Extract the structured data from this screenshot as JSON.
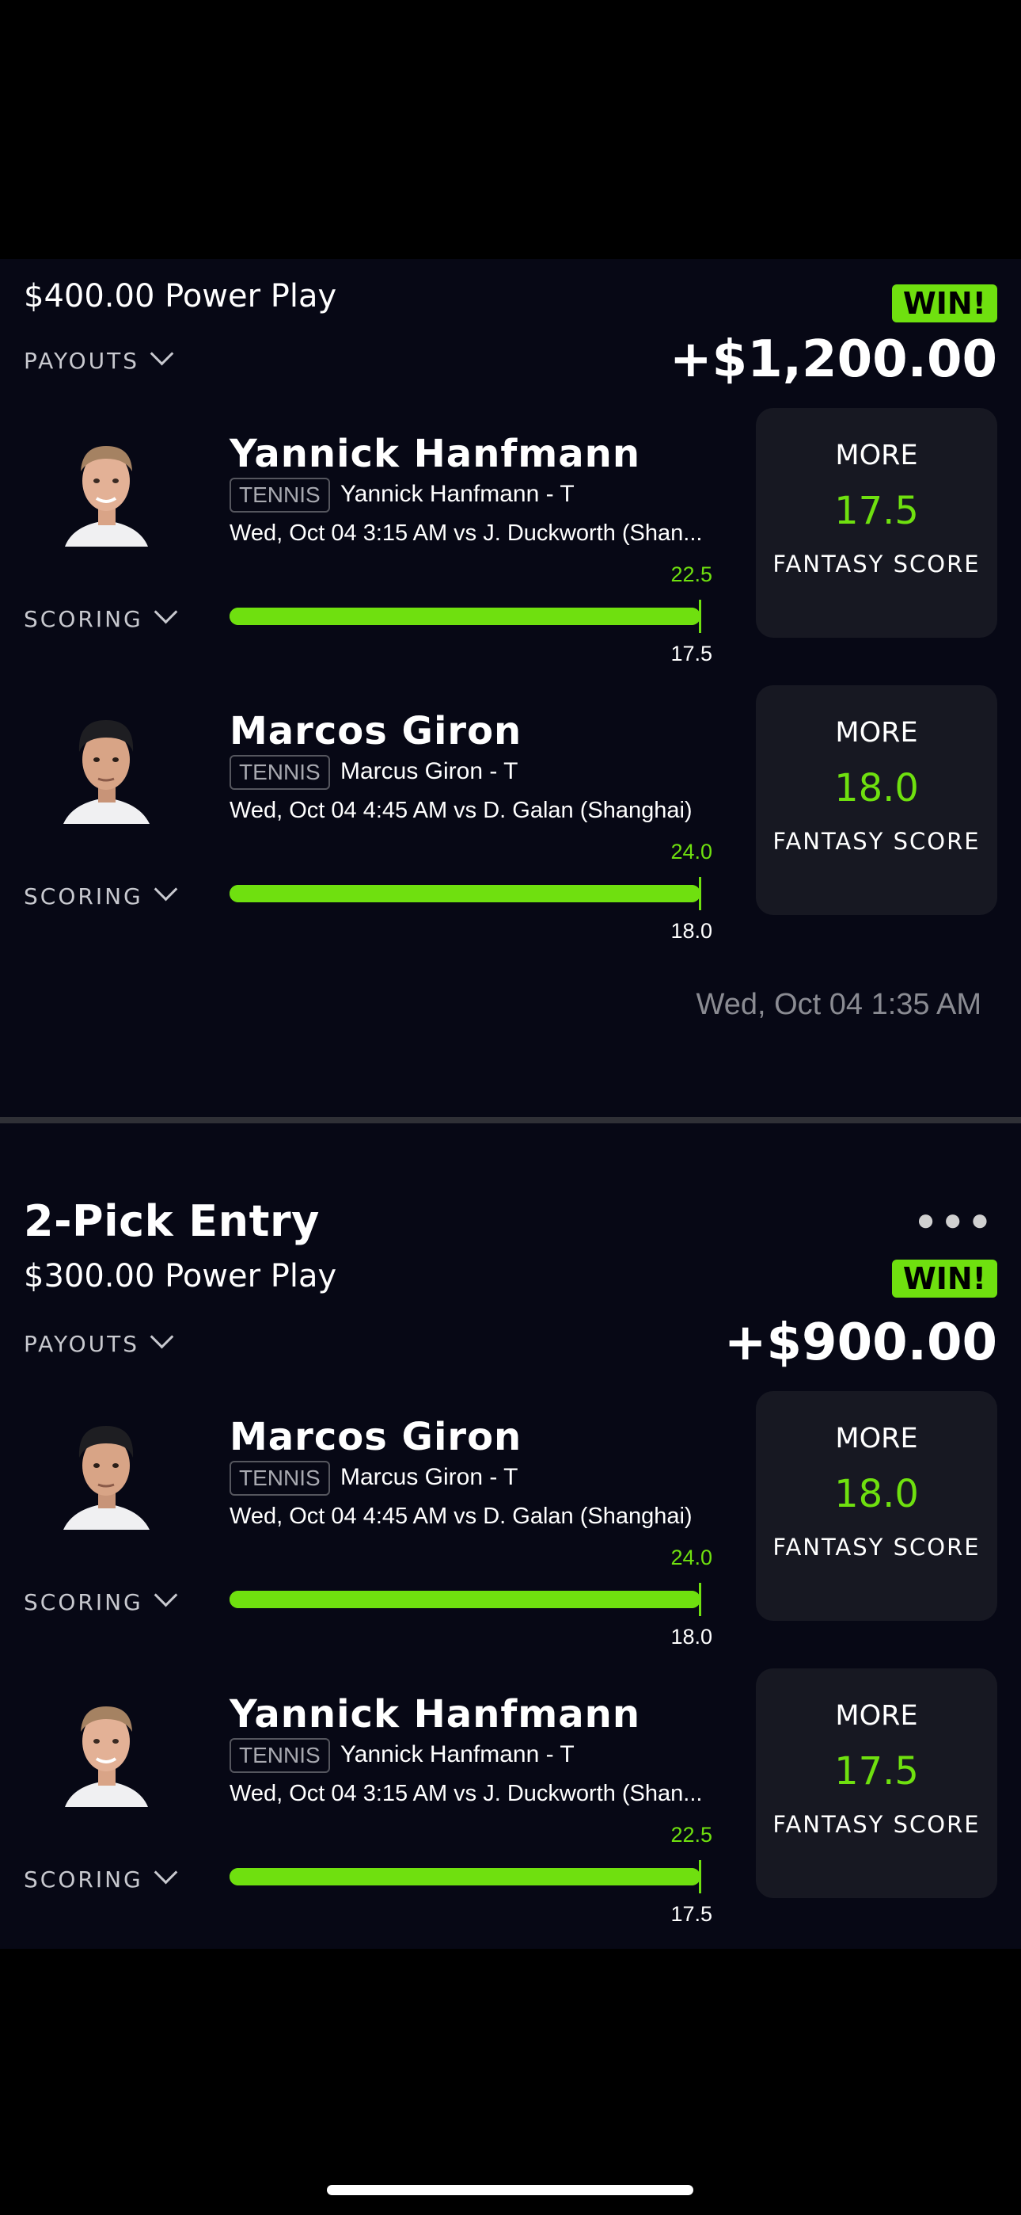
{
  "colors": {
    "accent": "#6fe00f",
    "background": "#070815",
    "panel": "#171822"
  },
  "entries": [
    {
      "power": "$400.00 Power Play",
      "badge": "WIN!",
      "payouts_label": "PAYOUTS",
      "amount": "+$1,200.00",
      "timestamp": "Wed, Oct 04 1:35 AM",
      "picks": [
        {
          "name": "Yannick Hanfmann",
          "sport": "TENNIS",
          "prop": "Yannick Hanfmann - T",
          "game": "Wed, Oct 04 3:15 AM  vs J. Duckworth (Shan...",
          "actual": "22.5",
          "line": "17.5",
          "progress": 1.0,
          "scoring_label": "SCORING",
          "direction": "MORE",
          "projection": "17.5",
          "stat": "FANTASY SCORE"
        },
        {
          "name": "Marcos Giron",
          "sport": "TENNIS",
          "prop": "Marcus Giron - T",
          "game": "Wed, Oct 04 4:45 AM  vs D. Galan (Shanghai)",
          "actual": "24.0",
          "line": "18.0",
          "progress": 1.0,
          "scoring_label": "SCORING",
          "direction": "MORE",
          "projection": "18.0",
          "stat": "FANTASY SCORE"
        }
      ]
    },
    {
      "title": "2-Pick Entry",
      "power": "$300.00 Power Play",
      "badge": "WIN!",
      "payouts_label": "PAYOUTS",
      "amount": "+$900.00",
      "more_icon": "more-dots-icon",
      "picks": [
        {
          "name": "Marcos Giron",
          "sport": "TENNIS",
          "prop": "Marcus Giron - T",
          "game": "Wed, Oct 04 4:45 AM  vs D. Galan (Shanghai)",
          "actual": "24.0",
          "line": "18.0",
          "progress": 1.0,
          "scoring_label": "SCORING",
          "direction": "MORE",
          "projection": "18.0",
          "stat": "FANTASY SCORE"
        },
        {
          "name": "Yannick Hanfmann",
          "sport": "TENNIS",
          "prop": "Yannick Hanfmann - T",
          "game": "Wed, Oct 04 3:15 AM  vs J. Duckworth (Shan...",
          "actual": "22.5",
          "line": "17.5",
          "progress": 1.0,
          "scoring_label": "SCORING",
          "direction": "MORE",
          "projection": "17.5",
          "stat": "FANTASY SCORE"
        }
      ]
    }
  ]
}
